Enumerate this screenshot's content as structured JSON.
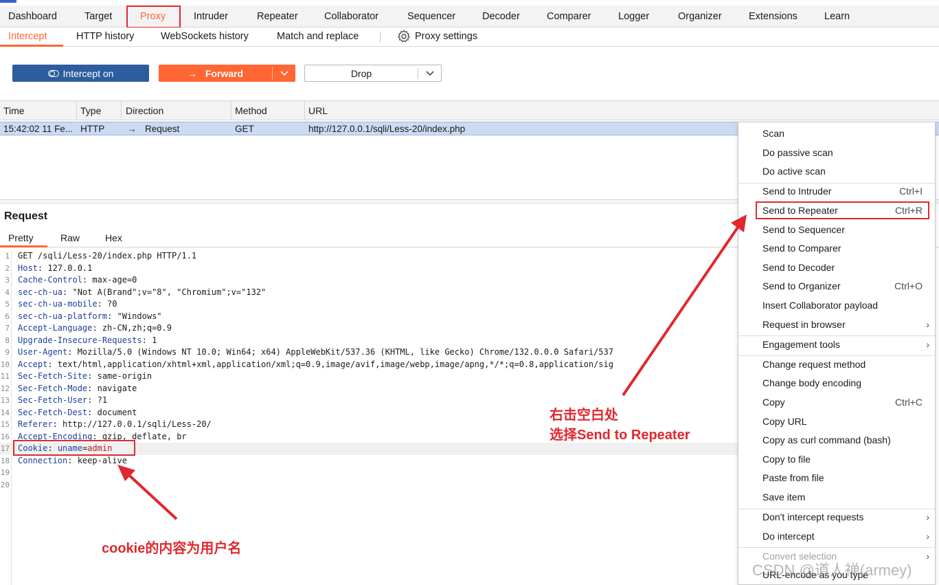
{
  "nav": {
    "tabs": [
      "Dashboard",
      "Target",
      "Proxy",
      "Intruder",
      "Repeater",
      "Collaborator",
      "Sequencer",
      "Decoder",
      "Comparer",
      "Logger",
      "Organizer",
      "Extensions",
      "Learn"
    ],
    "active": "Proxy"
  },
  "subnav": {
    "tabs": [
      "Intercept",
      "HTTP history",
      "WebSockets history",
      "Match and replace"
    ],
    "settings_label": "Proxy settings"
  },
  "actions": {
    "intercept_label": "Intercept on",
    "forward_label": "Forward",
    "drop_label": "Drop"
  },
  "table": {
    "columns": [
      "Time",
      "Type",
      "Direction",
      "Method",
      "URL"
    ],
    "row": {
      "time": "15:42:02 11 Fe...",
      "type": "HTTP",
      "direction": "Request",
      "method": "GET",
      "url": "http://127.0.0.1/sqli/Less-20/index.php"
    }
  },
  "request": {
    "title": "Request",
    "tabs": [
      "Pretty",
      "Raw",
      "Hex"
    ],
    "lines": [
      {
        "n": "1",
        "k": "",
        "v": "GET /sqli/Less-20/index.php HTTP/1.1"
      },
      {
        "n": "2",
        "k": "Host",
        "v": ": 127.0.0.1"
      },
      {
        "n": "3",
        "k": "Cache-Control",
        "v": ": max-age=0"
      },
      {
        "n": "4",
        "k": "sec-ch-ua",
        "v": ": \"Not A(Brand\";v=\"8\", \"Chromium\";v=\"132\""
      },
      {
        "n": "5",
        "k": "sec-ch-ua-mobile",
        "v": ": ?0"
      },
      {
        "n": "6",
        "k": "sec-ch-ua-platform",
        "v": ": \"Windows\""
      },
      {
        "n": "7",
        "k": "Accept-Language",
        "v": ": zh-CN,zh;q=0.9"
      },
      {
        "n": "8",
        "k": "Upgrade-Insecure-Requests",
        "v": ": 1"
      },
      {
        "n": "9",
        "k": "User-Agent",
        "v": ": Mozilla/5.0 (Windows NT 10.0; Win64; x64) AppleWebKit/537.36 (KHTML, like Gecko) Chrome/132.0.0.0 Safari/537"
      },
      {
        "n": "10",
        "k": "Accept",
        "v": ": text/html,application/xhtml+xml,application/xml;q=0.9,image/avif,image/webp,image/apng,*/*;q=0.8,application/sig"
      },
      {
        "n": "11",
        "k": "Sec-Fetch-Site",
        "v": ": same-origin"
      },
      {
        "n": "12",
        "k": "Sec-Fetch-Mode",
        "v": ": navigate"
      },
      {
        "n": "13",
        "k": "Sec-Fetch-User",
        "v": ": ?1"
      },
      {
        "n": "14",
        "k": "Sec-Fetch-Dest",
        "v": ": document"
      },
      {
        "n": "15",
        "k": "Referer",
        "v": ": http://127.0.0.1/sqli/Less-20/"
      },
      {
        "n": "16",
        "k": "Accept-Encoding",
        "v": ": gzip, deflate, br"
      },
      {
        "n": "17",
        "k": "Cookie",
        "v": "",
        "cookie_name": "uname",
        "cookie_value": "admin"
      },
      {
        "n": "18",
        "k": "Connection",
        "v": ": keep-alive"
      },
      {
        "n": "19",
        "k": "",
        "v": ""
      },
      {
        "n": "20",
        "k": "",
        "v": ""
      }
    ]
  },
  "context_menu": {
    "items": [
      {
        "label": "Scan",
        "shortcut": "",
        "submenu": false,
        "disabled": false
      },
      {
        "label": "Do passive scan",
        "shortcut": "",
        "submenu": false,
        "disabled": false
      },
      {
        "label": "Do active scan",
        "shortcut": "",
        "submenu": false,
        "disabled": false,
        "sep_after": true
      },
      {
        "label": "Send to Intruder",
        "shortcut": "Ctrl+I",
        "submenu": false,
        "disabled": false
      },
      {
        "label": "Send to Repeater",
        "shortcut": "Ctrl+R",
        "submenu": false,
        "disabled": false,
        "highlight": true
      },
      {
        "label": "Send to Sequencer",
        "shortcut": "",
        "submenu": false,
        "disabled": false
      },
      {
        "label": "Send to Comparer",
        "shortcut": "",
        "submenu": false,
        "disabled": false
      },
      {
        "label": "Send to Decoder",
        "shortcut": "",
        "submenu": false,
        "disabled": false
      },
      {
        "label": "Send to Organizer",
        "shortcut": "Ctrl+O",
        "submenu": false,
        "disabled": false
      },
      {
        "label": "Insert Collaborator payload",
        "shortcut": "",
        "submenu": false,
        "disabled": false
      },
      {
        "label": "Request in browser",
        "shortcut": "",
        "submenu": true,
        "disabled": false,
        "sep_after": true
      },
      {
        "label": "Engagement tools",
        "shortcut": "",
        "submenu": true,
        "disabled": false,
        "sep_after": true
      },
      {
        "label": "Change request method",
        "shortcut": "",
        "submenu": false,
        "disabled": false
      },
      {
        "label": "Change body encoding",
        "shortcut": "",
        "submenu": false,
        "disabled": false
      },
      {
        "label": "Copy",
        "shortcut": "Ctrl+C",
        "submenu": false,
        "disabled": false
      },
      {
        "label": "Copy URL",
        "shortcut": "",
        "submenu": false,
        "disabled": false
      },
      {
        "label": "Copy as curl command (bash)",
        "shortcut": "",
        "submenu": false,
        "disabled": false
      },
      {
        "label": "Copy to file",
        "shortcut": "",
        "submenu": false,
        "disabled": false
      },
      {
        "label": "Paste from file",
        "shortcut": "",
        "submenu": false,
        "disabled": false
      },
      {
        "label": "Save item",
        "shortcut": "",
        "submenu": false,
        "disabled": false,
        "sep_after": true
      },
      {
        "label": "Don't intercept requests",
        "shortcut": "",
        "submenu": true,
        "disabled": false
      },
      {
        "label": "Do intercept",
        "shortcut": "",
        "submenu": true,
        "disabled": false,
        "sep_after": true
      },
      {
        "label": "Convert selection",
        "shortcut": "",
        "submenu": true,
        "disabled": true
      },
      {
        "label": "URL-encode as you type",
        "shortcut": "",
        "submenu": false,
        "disabled": false
      }
    ]
  },
  "annotations": {
    "menu_note_line1": "右击空白处",
    "menu_note_line2": "选择Send to Repeater",
    "cookie_note": "cookie的内容为用户名",
    "watermark": "CSDN @道人禅(armey)"
  },
  "colors": {
    "accent": "#ff6633",
    "intercept_button": "#2c5d9e",
    "annotation_red": "#e0282e",
    "selected_row": "#cbdcf2"
  }
}
